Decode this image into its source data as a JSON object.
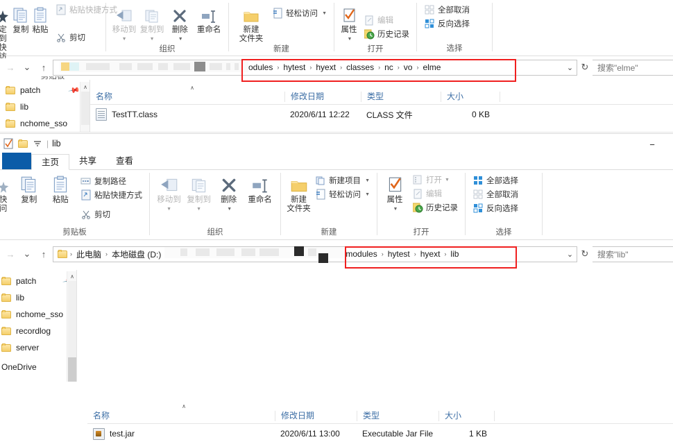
{
  "window_top": {
    "ribbon": {
      "groups": [
        {
          "label": "剪贴板",
          "big": [
            {
              "label_line1": "定到快",
              "label_line2": "访问",
              "icon": "pin-to-quick-access-icon",
              "disabled": false
            },
            {
              "label_line1": "复制",
              "label_line2": "",
              "icon": "copy-icon",
              "disabled": false
            },
            {
              "label_line1": "粘贴",
              "label_line2": "",
              "icon": "paste-icon",
              "disabled": false
            }
          ],
          "small": [
            {
              "label": "粘贴快捷方式",
              "icon": "paste-shortcut-icon",
              "disabled": true
            },
            {
              "label": "剪切",
              "icon": "cut-icon",
              "disabled": false
            }
          ]
        },
        {
          "label": "组织",
          "big": [
            {
              "label_line1": "移动到",
              "label_line2": "",
              "icon": "move-to-icon",
              "disabled": true,
              "caret": true
            },
            {
              "label_line1": "复制到",
              "label_line2": "",
              "icon": "copy-to-icon",
              "disabled": true,
              "caret": true
            },
            {
              "label_line1": "删除",
              "label_line2": "",
              "icon": "delete-icon",
              "disabled": false,
              "caret": true
            },
            {
              "label_line1": "重命名",
              "label_line2": "",
              "icon": "rename-icon",
              "disabled": false
            }
          ],
          "small": []
        },
        {
          "label": "新建",
          "big": [
            {
              "label_line1": "新建",
              "label_line2": "文件夹",
              "icon": "new-folder-icon",
              "disabled": false
            }
          ],
          "small": [
            {
              "label": "轻松访问",
              "icon": "easy-access-icon",
              "disabled": false,
              "caret": true
            }
          ]
        },
        {
          "label": "打开",
          "big": [
            {
              "label_line1": "属性",
              "label_line2": "",
              "icon": "properties-icon",
              "disabled": false,
              "caret": true
            }
          ],
          "small": [
            {
              "label": "编辑",
              "icon": "edit-icon",
              "disabled": true
            },
            {
              "label": "历史记录",
              "icon": "history-icon",
              "disabled": false
            }
          ]
        },
        {
          "label": "选择",
          "big": [],
          "small": [
            {
              "label": "全部取消",
              "icon": "select-none-icon",
              "disabled": false
            },
            {
              "label": "反向选择",
              "icon": "invert-selection-icon",
              "disabled": false
            }
          ]
        }
      ]
    },
    "address": {
      "crumbs": [
        "modules",
        "hytest",
        "hyext",
        "classes",
        "nc",
        "vo",
        "elme"
      ],
      "separator": "›",
      "dropdown_icon": "chevron-down-icon",
      "refresh_icon": "refresh-icon",
      "refresh_glyph": "↻",
      "back_glyph": "←",
      "forward_glyph": "→",
      "recent_glyph": "⌄",
      "up_glyph": "↑"
    },
    "search": {
      "placeholder": "搜索\"elme\""
    },
    "nav_items": [
      {
        "label": "patch",
        "pinned": true
      },
      {
        "label": "lib",
        "pinned": false
      },
      {
        "label": "nchome_sso",
        "pinned": false
      }
    ],
    "columns": [
      "名称",
      "修改日期",
      "类型",
      "大小"
    ],
    "files": [
      {
        "name": "TestTT.class",
        "modified": "2020/6/11 12:22",
        "type": "CLASS 文件",
        "size": "0 KB",
        "icon": "class-file-icon"
      }
    ]
  },
  "window_bottom": {
    "title": "lib",
    "title_icons": [
      "check-document-icon",
      "folder-icon",
      "customize-quick-access-icon"
    ],
    "minimize_glyph": "−",
    "tabs": [
      {
        "label": "主页",
        "active": true
      },
      {
        "label": "共享",
        "active": false
      },
      {
        "label": "查看",
        "active": false
      }
    ],
    "ribbon": {
      "groups": [
        {
          "label": "剪贴板",
          "big": [
            {
              "label_line1": "快",
              "label_line2": "问",
              "icon": "pin-to-quick-access-icon",
              "disabled": false
            },
            {
              "label_line1": "复制",
              "label_line2": "",
              "icon": "copy-icon",
              "disabled": false
            },
            {
              "label_line1": "粘贴",
              "label_line2": "",
              "icon": "paste-icon",
              "disabled": false
            }
          ],
          "small": [
            {
              "label": "复制路径",
              "icon": "copy-path-icon",
              "disabled": false
            },
            {
              "label": "粘贴快捷方式",
              "icon": "paste-shortcut-icon",
              "disabled": false
            },
            {
              "label": "剪切",
              "icon": "cut-icon",
              "disabled": false
            }
          ]
        },
        {
          "label": "组织",
          "big": [
            {
              "label_line1": "移动到",
              "label_line2": "",
              "icon": "move-to-icon",
              "disabled": true,
              "caret": true
            },
            {
              "label_line1": "复制到",
              "label_line2": "",
              "icon": "copy-to-icon",
              "disabled": true,
              "caret": true
            },
            {
              "label_line1": "删除",
              "label_line2": "",
              "icon": "delete-icon",
              "disabled": false,
              "caret": true
            },
            {
              "label_line1": "重命名",
              "label_line2": "",
              "icon": "rename-icon",
              "disabled": false
            }
          ],
          "small": []
        },
        {
          "label": "新建",
          "big": [
            {
              "label_line1": "新建",
              "label_line2": "文件夹",
              "icon": "new-folder-icon",
              "disabled": false
            }
          ],
          "small": [
            {
              "label": "新建项目",
              "icon": "new-item-icon",
              "disabled": false,
              "caret": true
            },
            {
              "label": "轻松访问",
              "icon": "easy-access-icon",
              "disabled": false,
              "caret": true
            }
          ]
        },
        {
          "label": "打开",
          "big": [
            {
              "label_line1": "属性",
              "label_line2": "",
              "icon": "properties-icon",
              "disabled": false,
              "caret": true
            }
          ],
          "small": [
            {
              "label": "打开",
              "icon": "open-icon",
              "disabled": true,
              "caret": true
            },
            {
              "label": "编辑",
              "icon": "edit-icon",
              "disabled": true
            },
            {
              "label": "历史记录",
              "icon": "history-icon",
              "disabled": false
            }
          ]
        },
        {
          "label": "选择",
          "big": [],
          "small": [
            {
              "label": "全部选择",
              "icon": "select-all-icon",
              "disabled": false
            },
            {
              "label": "全部取消",
              "icon": "select-none-icon",
              "disabled": false
            },
            {
              "label": "反向选择",
              "icon": "invert-selection-icon",
              "disabled": false
            }
          ]
        }
      ]
    },
    "address": {
      "crumbs_left": [
        "此电脑",
        "本地磁盘 (D:)"
      ],
      "crumbs": [
        "modules",
        "hytest",
        "hyext",
        "lib"
      ],
      "separator": "›",
      "back_glyph": "→",
      "recent_glyph": "⌄",
      "up_glyph": "↑",
      "dropdown_icon": "chevron-down-icon",
      "refresh_glyph": "↻"
    },
    "search": {
      "placeholder": "搜索\"lib\""
    },
    "nav_items": [
      {
        "label": "patch",
        "pinned": true
      },
      {
        "label": "lib",
        "pinned": false
      },
      {
        "label": "nchome_sso",
        "pinned": false
      },
      {
        "label": "recordlog",
        "pinned": false
      },
      {
        "label": "server",
        "pinned": false
      },
      {
        "label": "OneDrive",
        "pinned": false,
        "no_icon": true
      }
    ],
    "columns": [
      "名称",
      "修改日期",
      "类型",
      "大小"
    ],
    "files": [
      {
        "name": "test.jar",
        "modified": "2020/6/11 13:00",
        "type": "Executable Jar File",
        "size": "1 KB",
        "icon": "jar-file-icon"
      }
    ]
  },
  "highlight_color": "#f01f1f"
}
